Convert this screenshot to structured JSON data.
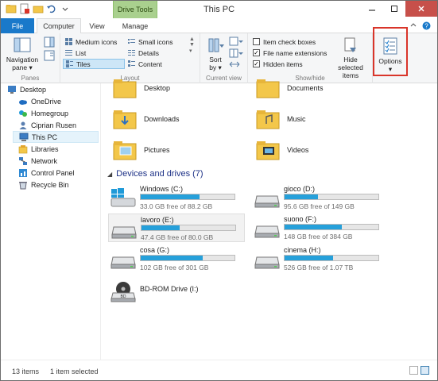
{
  "window": {
    "title": "This PC",
    "context_tab_group": "Drive Tools"
  },
  "tabs": [
    {
      "label": "File"
    },
    {
      "label": "Computer"
    },
    {
      "label": "View"
    },
    {
      "label": "Manage"
    }
  ],
  "ribbon": {
    "panes": {
      "group_label": "Panes",
      "navigation_pane": "Navigation",
      "navigation_pane_2": "pane ▾"
    },
    "layout": {
      "group_label": "Layout",
      "items": [
        "Medium icons",
        "Small icons",
        "List",
        "Details",
        "Tiles",
        "Content"
      ],
      "selected": "Tiles"
    },
    "current_view": {
      "group_label": "Current view",
      "sort_by": "Sort",
      "sort_by_2": "by ▾"
    },
    "show_hide": {
      "group_label": "Show/hide",
      "item_check_boxes": "Item check boxes",
      "item_check_boxes_checked": false,
      "file_name_extensions": "File name extensions",
      "file_name_extensions_checked": true,
      "hidden_items": "Hidden items",
      "hidden_items_checked": true,
      "hide_selected": "Hide selected",
      "hide_selected_2": "items"
    },
    "options": {
      "label": "Options",
      "arrow": "▾",
      "highlight_color": "#d9352a"
    }
  },
  "nav": {
    "items": [
      {
        "label": "Desktop",
        "icon": "desktop-icon"
      },
      {
        "label": "OneDrive",
        "icon": "cloud-icon"
      },
      {
        "label": "Homegroup",
        "icon": "homegroup-icon"
      },
      {
        "label": "Ciprian Rusen",
        "icon": "user-icon"
      },
      {
        "label": "This PC",
        "icon": "computer-icon",
        "selected": true
      },
      {
        "label": "Libraries",
        "icon": "libraries-icon"
      },
      {
        "label": "Network",
        "icon": "network-icon"
      },
      {
        "label": "Control Panel",
        "icon": "control-panel-icon"
      },
      {
        "label": "Recycle Bin",
        "icon": "recycle-bin-icon"
      }
    ]
  },
  "folders": [
    {
      "label": "Desktop"
    },
    {
      "label": "Documents"
    },
    {
      "label": "Downloads"
    },
    {
      "label": "Music"
    },
    {
      "label": "Pictures"
    },
    {
      "label": "Videos"
    }
  ],
  "devices": {
    "heading": "Devices and drives (7)",
    "drives": [
      {
        "name": "Windows (C:)",
        "free": "33.0 GB free of 88.2 GB",
        "used_fraction": 0.63
      },
      {
        "name": "gioco (D:)",
        "free": "95.6 GB free of 149 GB",
        "used_fraction": 0.36
      },
      {
        "name": "lavoro (E:)",
        "free": "47.4 GB free of 80.0 GB",
        "used_fraction": 0.41,
        "selected": true
      },
      {
        "name": "suono (F:)",
        "free": "148 GB free of 384 GB",
        "used_fraction": 0.61
      },
      {
        "name": "cosa (G:)",
        "free": "102 GB free of 301 GB",
        "used_fraction": 0.66
      },
      {
        "name": "cinema (H:)",
        "free": "526 GB free of 1.07 TB",
        "used_fraction": 0.52
      },
      {
        "name": "BD-ROM Drive (I:)",
        "free": "",
        "used_fraction": null
      }
    ]
  },
  "status": {
    "items": "13 items",
    "selected": "1 item selected"
  },
  "colors": {
    "accent": "#1979ca",
    "drive_bar": "#26a0da",
    "context_tab": "#a9d08e"
  }
}
